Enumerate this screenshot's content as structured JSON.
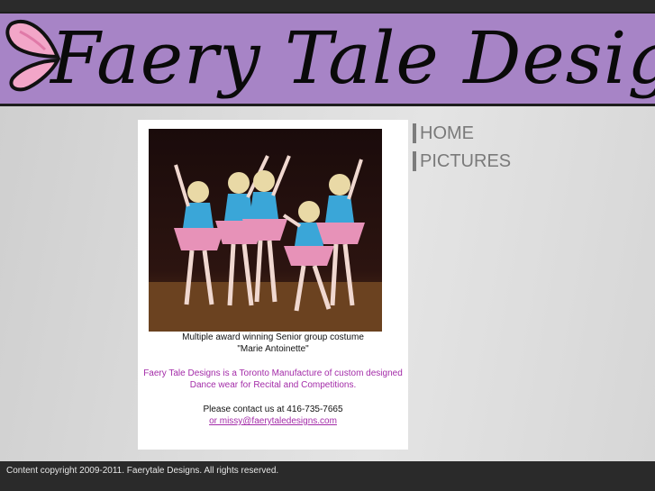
{
  "brand": {
    "title": "Faery Tale Designs",
    "accent": "#a784c6"
  },
  "nav": {
    "items": [
      {
        "label": "HOME"
      },
      {
        "label": "PICTURES"
      }
    ]
  },
  "content": {
    "caption_line1": "Multiple award winning Senior group costume",
    "caption_line2": "\"Marie Antoinette\"",
    "description_line1": "Faery Tale Designs is a Toronto Manufacture of custom designed",
    "description_line2": "Dance wear for Recital and Competitions.",
    "contact_line": "Please contact us at 416-735-7665",
    "email_link": "or missy@faerytaledesigns.com"
  },
  "footer": {
    "copyright": "Content copyright 2009-2011. Faerytale Designs. All rights reserved."
  },
  "colors": {
    "link_purple": "#a32ba8",
    "footer_bg": "#2a2a2a"
  }
}
